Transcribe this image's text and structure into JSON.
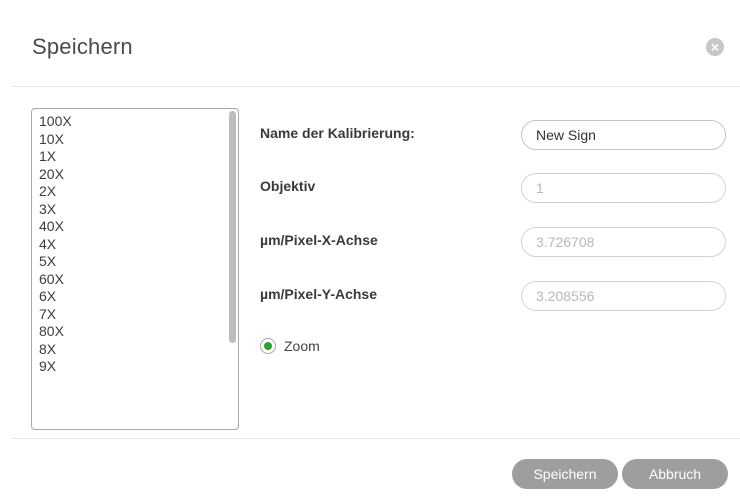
{
  "dialog": {
    "title": "Speichern",
    "close_glyph": "×"
  },
  "objectives_list": {
    "items": [
      "100X",
      "10X",
      "1X",
      "20X",
      "2X",
      "3X",
      "40X",
      "4X",
      "5X",
      "60X",
      "6X",
      "7X",
      "80X",
      "8X",
      "9X"
    ]
  },
  "form": {
    "calibration_name": {
      "label": "Name der Kalibrierung:",
      "value": "New Sign"
    },
    "objective": {
      "label": "Objektiv",
      "value": "1"
    },
    "um_per_pixel_x": {
      "label": "µm/Pixel-X-Achse",
      "value": "3.726708"
    },
    "um_per_pixel_y": {
      "label": "µm/Pixel-Y-Achse",
      "value": "3.208556"
    },
    "zoom": {
      "label": "Zoom",
      "selected": true
    }
  },
  "footer": {
    "save_label": "Speichern",
    "cancel_label": "Abbruch"
  },
  "colors": {
    "button_bg": "#9e9e9e",
    "radio_selected": "#2aa22a",
    "close_icon_bg": "#c7c7c7"
  }
}
